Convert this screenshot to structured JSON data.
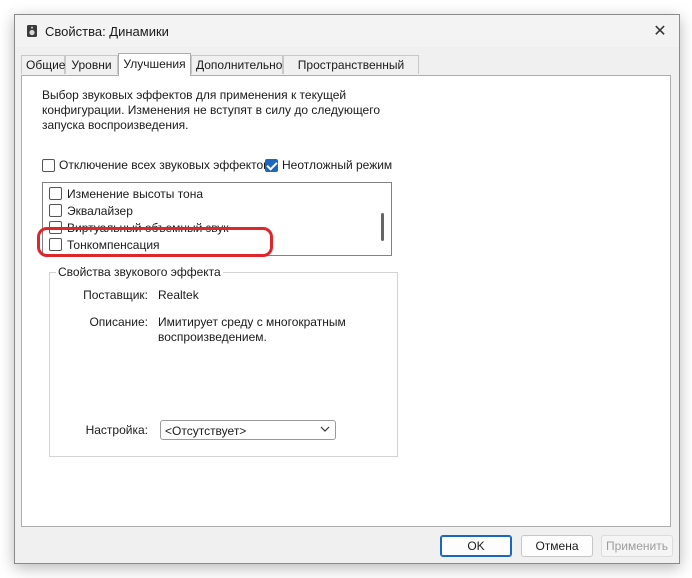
{
  "window": {
    "title": "Свойства: Динамики"
  },
  "tabs": [
    {
      "label": "Общие"
    },
    {
      "label": "Уровни"
    },
    {
      "label": "Улучшения"
    },
    {
      "label": "Дополнительно"
    },
    {
      "label": "Пространственный звук"
    }
  ],
  "active_tab": "Улучшения",
  "description": [
    "Выбор звуковых эффектов для применения к текущей",
    "конфигурации. Изменения не вступят в силу до следующего",
    "запуска воспроизведения."
  ],
  "options": {
    "disable_all": {
      "label": "Отключение всех звуковых эффектов",
      "checked": false
    },
    "immediate_mode": {
      "label": "Неотложный режим",
      "checked": true
    }
  },
  "effects_list": [
    {
      "label": "Изменение высоты тона",
      "checked": false
    },
    {
      "label": "Эквалайзер",
      "checked": false
    },
    {
      "label": "Виртуальный объемный звук",
      "checked": false
    },
    {
      "label": "Тонкомпенсация",
      "checked": false
    }
  ],
  "properties": {
    "group_title": "Свойства звукового эффекта",
    "provider_label": "Поставщик:",
    "provider_value": "Realtek",
    "description_label": "Описание:",
    "description_value_lines": [
      "Имитирует среду с многократным",
      "воспроизведением."
    ],
    "setting_label": "Настройка:",
    "setting_value": "<Отсутствует>"
  },
  "buttons": {
    "ok": "OK",
    "cancel": "Отмена",
    "apply": "Применить"
  },
  "colors": {
    "accent": "#1a67c0",
    "highlight": "#e0262d"
  }
}
